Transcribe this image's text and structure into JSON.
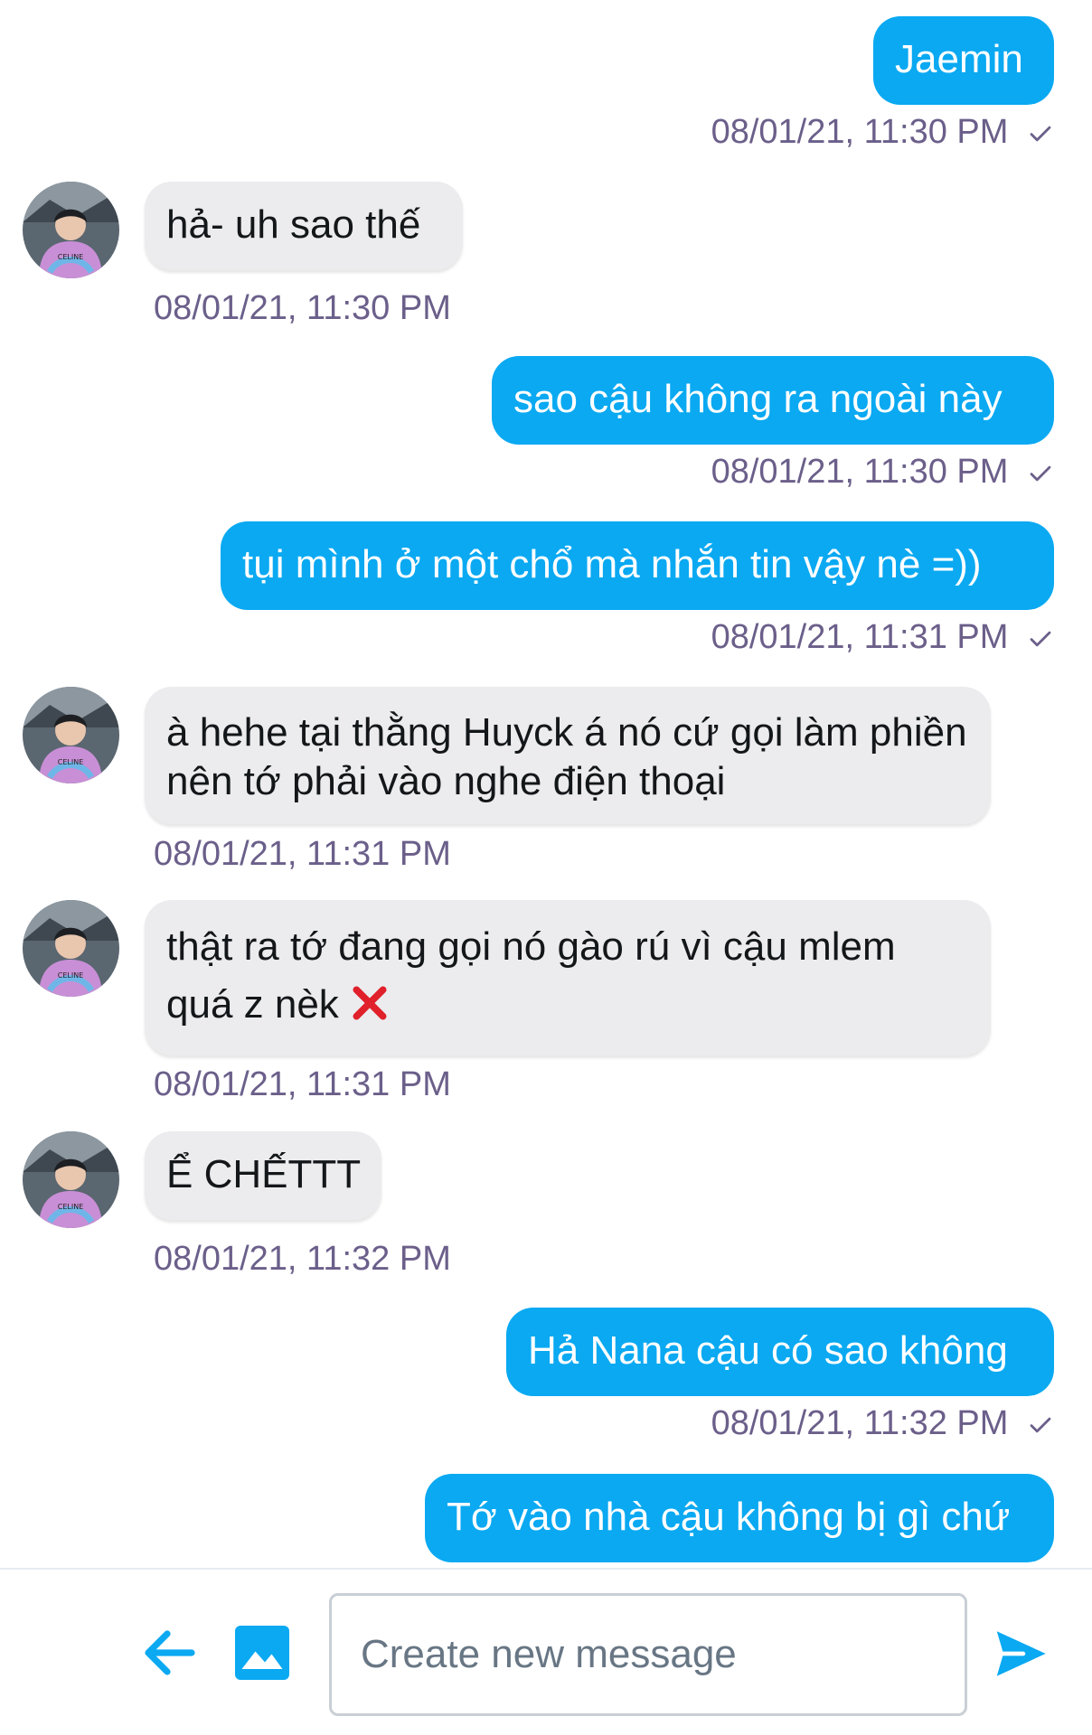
{
  "conversation": {
    "messages": [
      {
        "direction": "out",
        "text": "Jaemin",
        "timestamp": "08/01/21, 11:30 PM",
        "read": true
      },
      {
        "direction": "in",
        "text": "hả- uh sao thế",
        "timestamp": "08/01/21, 11:30 PM"
      },
      {
        "direction": "out",
        "text": "sao cậu không ra ngoài này",
        "timestamp": "08/01/21, 11:30 PM",
        "read": true
      },
      {
        "direction": "out",
        "text": "tụi mình ở một chổ mà nhắn tin vậy nè =))",
        "timestamp": "08/01/21, 11:31 PM",
        "read": true
      },
      {
        "direction": "in",
        "text": "à hehe tại thằng Huyck á nó cứ gọi làm phiền nên tớ phải vào nghe điện thoại",
        "timestamp": "08/01/21, 11:31 PM"
      },
      {
        "direction": "in",
        "text": "thật ra tớ đang gọi nó gào rú vì cậu mlem quá z nèk",
        "emoji": "cross-mark",
        "timestamp": "08/01/21, 11:31 PM"
      },
      {
        "direction": "in",
        "text": "Ể CHẾTTT",
        "timestamp": "08/01/21, 11:32 PM"
      },
      {
        "direction": "out",
        "text": "Hả Nana cậu có sao không",
        "timestamp": "08/01/21, 11:32 PM",
        "read": true
      },
      {
        "direction": "out",
        "text": "Tớ vào nhà cậu không bị gì chứ",
        "timestamp": ""
      }
    ]
  },
  "composer": {
    "placeholder": "Create new message",
    "value": "",
    "back_icon": "arrow-left-icon",
    "media_icon": "image-icon",
    "send_icon": "send-icon"
  },
  "colors": {
    "accent": "#0aa9f2",
    "incoming_bubble": "#ececee",
    "timestamp": "#6b5f8a"
  }
}
